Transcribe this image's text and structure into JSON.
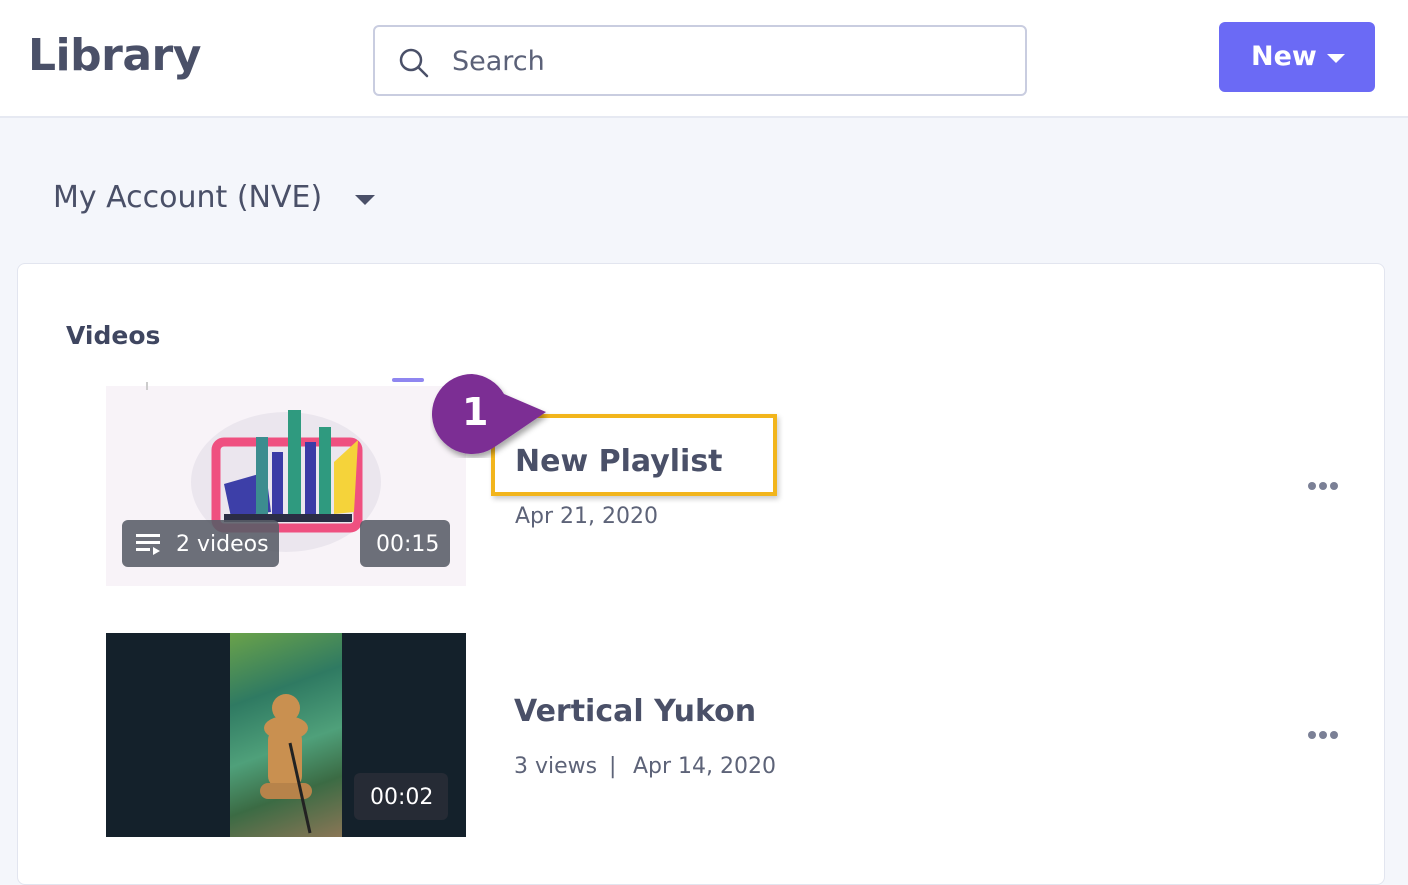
{
  "header": {
    "title": "Library",
    "search_placeholder": "Search",
    "new_button_label": "New"
  },
  "account": {
    "label": "My Account (NVE)"
  },
  "videos_section": {
    "heading": "Videos",
    "items": [
      {
        "title": "New Playlist",
        "date": "Apr 21, 2020",
        "count_badge": "2 videos",
        "duration": "00:15"
      },
      {
        "title": "Vertical Yukon",
        "views": "3 views",
        "separator": "|",
        "date": "Apr 14, 2020",
        "duration": "00:02"
      }
    ]
  },
  "callout": {
    "number": "1",
    "color": "#7b2d94",
    "highlight_color": "#f2b51c"
  },
  "colors": {
    "accent": "#6b6af5",
    "text": "#4a5068",
    "background": "#f4f6fb"
  },
  "icons": [
    "search-icon",
    "caret-down-icon",
    "playlist-icon",
    "more-options-icon"
  ]
}
